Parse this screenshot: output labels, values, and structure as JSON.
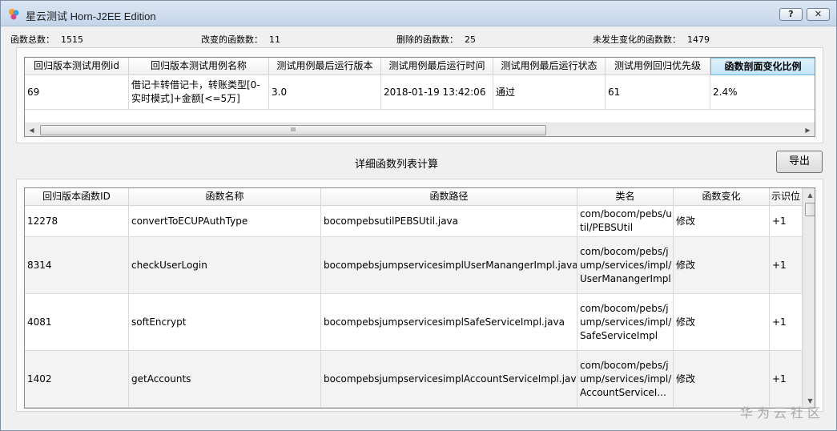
{
  "window": {
    "title": "星云测试 Horn-J2EE Edition",
    "help_label": "?",
    "close_label": "✕"
  },
  "stats": {
    "total_label": "函数总数：",
    "total_value": "1515",
    "changed_label": "改变的函数数：",
    "changed_value": "11",
    "deleted_label": "删除的函数数：",
    "deleted_value": "25",
    "unchanged_label": "未发生变化的函数数：",
    "unchanged_value": "1479"
  },
  "top_table": {
    "headers": [
      "回归版本测试用例id",
      "回归版本测试用例名称",
      "测试用例最后运行版本",
      "测试用例最后运行时间",
      "测试用例最后运行状态",
      "测试用例回归优先级",
      "函数剖面变化比例"
    ],
    "rows": [
      [
        "69",
        "借记卡转借记卡，转账类型[0-实时模式]+金额[<=5万]",
        "3.0",
        "2018-01-19 13:42:06",
        "通过",
        "61",
        "2.4%"
      ]
    ],
    "thumb_glyph": "III"
  },
  "detail": {
    "title": "详细函数列表计算",
    "export_label": "导出"
  },
  "bottom_table": {
    "headers": [
      "回归版本函数ID",
      "函数名称",
      "函数路径",
      "类名",
      "函数变化",
      "示识位"
    ],
    "rows": [
      [
        "12278",
        "convertToECUPAuthType",
        "bocompebsutilPEBSUtil.java",
        "com/bocom/pebs/util/PEBSUtil",
        "修改",
        "+1"
      ],
      [
        "8314",
        "checkUserLogin",
        "bocompebsjumpservicesimplUserManangerImpl.java",
        "com/bocom/pebs/jump/services/impl/UserManangerImpl",
        "修改",
        "+1"
      ],
      [
        "4081",
        "softEncrypt",
        "bocompebsjumpservicesimplSafeServiceImpl.java",
        "com/bocom/pebs/jump/services/impl/SafeServiceImpl",
        "修改",
        "+1"
      ],
      [
        "1402",
        "getAccounts",
        "bocompebsjumpservicesimplAccountServiceImpl.java",
        "com/bocom/pebs/jump/services/impl/AccountServiceI...",
        "修改",
        "+1"
      ]
    ]
  },
  "watermark": "华为云社区",
  "colors": {
    "active_header": "#c2e4f7",
    "title_bar": "#c4d5ea"
  }
}
